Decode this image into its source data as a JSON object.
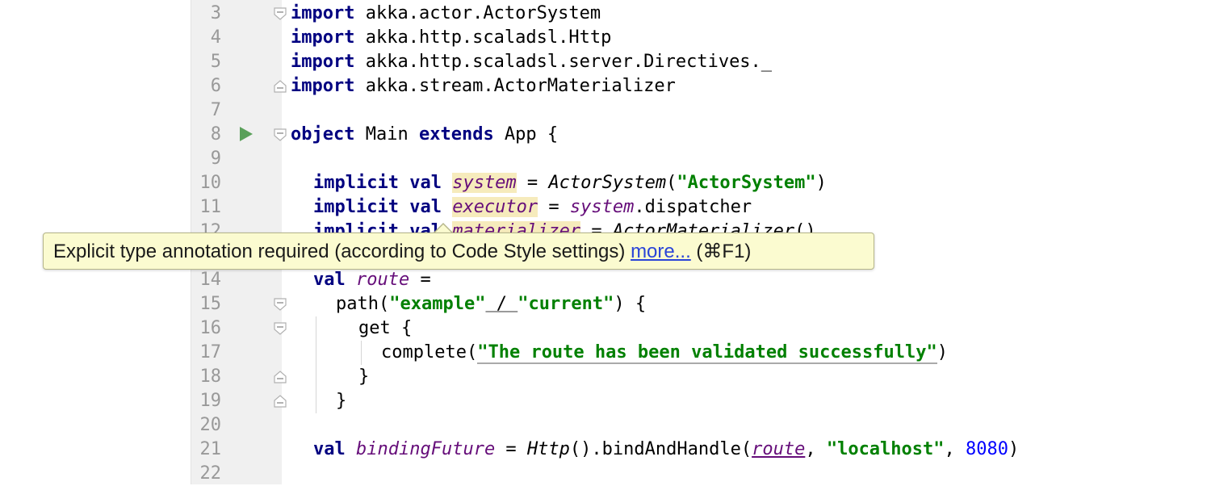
{
  "gutter": {
    "line_numbers": [
      "3",
      "4",
      "5",
      "6",
      "7",
      "8",
      "9",
      "10",
      "11",
      "12",
      "14",
      "15",
      "16",
      "17",
      "18",
      "19",
      "20",
      "21",
      "22"
    ]
  },
  "code": {
    "line3": {
      "kw": "import",
      "rest": " akka.actor.ActorSystem"
    },
    "line4": {
      "kw": "import",
      "rest": " akka.http.scaladsl.Http"
    },
    "line5": {
      "kw": "import",
      "rest": " akka.http.scaladsl.server.Directives._"
    },
    "line6": {
      "kw": "import",
      "rest": " akka.stream.ActorMaterializer"
    },
    "line8": {
      "kw1": "object",
      "mid1": " Main ",
      "kw2": "extends",
      "rest": " App {"
    },
    "line10": {
      "kw": "implicit val",
      "name": "system",
      "eq": " = ",
      "call": "ActorSystem",
      "open": "(",
      "str": "\"ActorSystem\"",
      "close": ")"
    },
    "line11": {
      "kw": "implicit val",
      "name": "executor",
      "eq": " = ",
      "obj": "system",
      "rest": ".dispatcher"
    },
    "line12": {
      "kw": "implicit val",
      "name": "materializer",
      "eq": " = ",
      "call": "ActorMaterializer",
      "rest": "()"
    },
    "line14": {
      "kw": "val",
      "name": "route",
      "rest": " ="
    },
    "line15": {
      "pre": "path(",
      "str1": "\"example\"",
      "mid": " / ",
      "str2": "\"current\"",
      "rest": ") {"
    },
    "line16": {
      "text": "get {"
    },
    "line17": {
      "pre": "complete(",
      "str": "\"The route has been validated successfully\"",
      "rest": ")"
    },
    "line18": {
      "text": "}"
    },
    "line19": {
      "text": "}"
    },
    "line21": {
      "kw": "val",
      "name": "bindingFuture",
      "eq": " = ",
      "call": "Http",
      "mid": "().bindAndHandle(",
      "arg": "route",
      "comma": ", ",
      "str": "\"localhost\"",
      "comma2": ", ",
      "num": "8080",
      "rest": ")"
    }
  },
  "tooltip": {
    "message": "Explicit type annotation required (according to Code Style settings) ",
    "link": "more...",
    "shortcut": " (⌘F1)"
  },
  "colors": {
    "keyword": "#000080",
    "string": "#008000",
    "number": "#0000ff",
    "field": "#660e7a",
    "highlight": "#f6ebbc",
    "tooltip_bg": "#fbfbd0",
    "link": "#2a44d8"
  },
  "icons": [
    "run-gutter-icon",
    "fold-open-icon",
    "fold-close-icon"
  ]
}
